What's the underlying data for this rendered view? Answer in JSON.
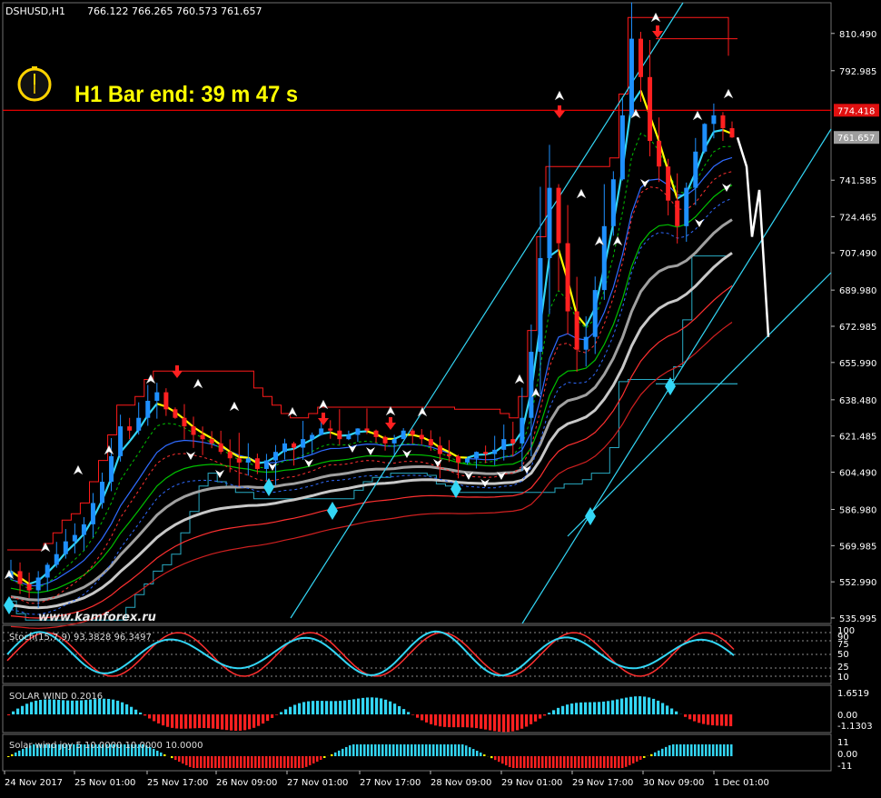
{
  "header": {
    "symbol_title": "DSHUSD,H1",
    "ohlc": "766.122 766.265 760.573 761.657"
  },
  "bar_timer": {
    "text": "H1 Bar end: 39 m 47 s",
    "icon": "clock-icon"
  },
  "watermark": "www.kamforex.ru",
  "colors": {
    "background": "#000000",
    "bull": "#1e90ff",
    "bear": "#ff2020",
    "channel": "#ff1a1a",
    "cyan": "#33d6f5",
    "yellow": "#ffff00",
    "price_line": "#ff0000",
    "price_tag": "#9e9e9e",
    "label": "#ffffff"
  },
  "price_tags": {
    "resistance": "774.418",
    "current": "761.657"
  },
  "oscillators": {
    "stoch": {
      "label": "Stoch(15,7,9) 93.3828 96.3497",
      "levels": [
        "100",
        "90",
        "75",
        "50",
        "25",
        "10"
      ]
    },
    "solar_wind": {
      "label": "SOLAR WIND 0.2016",
      "levels": [
        "1.6519",
        "0.00",
        "-1.1303"
      ]
    },
    "solar_wind_joy": {
      "label": "Solar wind joy 5 10.0000 10.0000 10.0000",
      "levels": [
        "11",
        "0.00",
        "-11"
      ]
    }
  },
  "chart_data": {
    "type": "candlestick",
    "title": "DSHUSD,H1",
    "y_ticks": [
      "810.490",
      "792.985",
      "774.418",
      "761.657",
      "741.585",
      "724.465",
      "707.490",
      "689.980",
      "672.985",
      "655.990",
      "638.480",
      "621.485",
      "604.490",
      "586.980",
      "569.985",
      "552.990",
      "535.995"
    ],
    "ylim": [
      535.995,
      818.5
    ],
    "x_ticks": [
      "24 Nov 2017",
      "25 Nov 01:00",
      "25 Nov 17:00",
      "26 Nov 09:00",
      "27 Nov 01:00",
      "27 Nov 17:00",
      "28 Nov 09:00",
      "29 Nov 01:00",
      "29 Nov 17:00",
      "30 Nov 09:00",
      "1 Dec 01:00"
    ],
    "close_series": [
      558,
      552,
      549,
      555,
      561,
      566,
      572,
      575,
      580,
      590,
      600,
      612,
      626,
      624,
      630,
      638,
      642,
      634,
      630,
      626,
      622,
      620,
      618,
      614,
      611,
      609,
      611,
      606,
      610,
      614,
      618,
      616,
      620,
      622,
      625,
      624,
      620,
      622,
      625,
      624,
      621,
      618,
      620,
      624,
      622,
      620,
      617,
      613,
      612,
      609,
      611,
      614,
      613,
      615,
      620,
      618,
      630,
      661,
      705,
      738,
      712,
      680,
      662,
      668,
      690,
      720,
      742,
      772,
      808,
      790,
      760,
      748,
      732,
      720,
      738,
      755,
      768,
      772,
      766,
      761.657
    ],
    "forecast": [
      761.657,
      748,
      715,
      737,
      668
    ],
    "annotations": {
      "high": "810.490",
      "low_29nov": "586.980"
    },
    "grid": false,
    "legend": "none"
  }
}
